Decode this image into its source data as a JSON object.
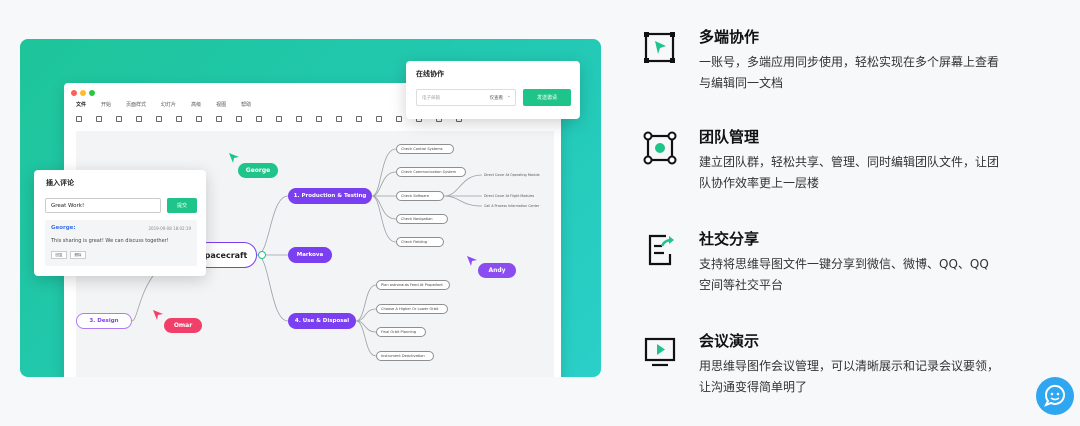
{
  "editor": {
    "menu": [
      "文件",
      "开始",
      "页面样式",
      "幻灯片",
      "高级",
      "视图",
      "帮助"
    ],
    "root_node": "pacecraft",
    "branches": [
      {
        "label": "1. Production & Testing",
        "color": "#7b3ff2"
      },
      {
        "label": "Markova",
        "color": "#7b3ff2"
      },
      {
        "label": "4. Use & Disposal",
        "color": "#7b3ff2"
      },
      {
        "label": "3. Design",
        "color": "#7b3ff2"
      }
    ],
    "leaves_top": [
      "Check Control Systems",
      "Check Communication System",
      "Check Software",
      "Check Navigation",
      "Check Fielding"
    ],
    "leaves_software": [
      "Direct Cover At Operating Module",
      "Direct Cover At Flight Modules",
      "Call A Process Information Center"
    ],
    "leaves_bottom": [
      "Plan astronauts Feed At Propellant",
      "Choose A Higher Or Lower Orbit",
      "Final Orbit Planning",
      "Instrument Deactivation"
    ],
    "collaborators": [
      {
        "name": "George",
        "color": "#1fc48a"
      },
      {
        "name": "Andy",
        "color": "#8b4cf0"
      },
      {
        "name": "Omar",
        "color": "#f0406a"
      }
    ]
  },
  "collab_card": {
    "title": "在线协作",
    "input_placeholder": "电子邮箱",
    "permission": "仅查看",
    "button": "发送邀请"
  },
  "comment_card": {
    "title": "插入评论",
    "input_value": "Great Work!",
    "submit": "提交",
    "author": "George:",
    "time": "2019-09-08 18:02:19",
    "text": "This sharing is great! We can discuss together!",
    "reply": "回复",
    "delete": "删除"
  },
  "features": [
    {
      "title": "多端协作",
      "desc": "一账号，多端应用同步使用，轻松实现在多个屏幕上查看与编辑同一文档",
      "icon": "multi-device-icon"
    },
    {
      "title": "团队管理",
      "desc": "建立团队群，轻松共享、管理、同时编辑团队文件，让团队协作效率更上一层楼",
      "icon": "team-icon"
    },
    {
      "title": "社交分享",
      "desc": "支持将思维导图文件一键分享到微信、微博、QQ、QQ空间等社交平台",
      "icon": "share-icon"
    },
    {
      "title": "会议演示",
      "desc": "用思维导图作会议管理，可以清晰展示和记录会议要领，让沟通变得简单明了",
      "icon": "presentation-icon"
    }
  ],
  "colors": {
    "accent": "#1fc48a",
    "purple": "#7b3ff2",
    "chat": "#2ea7f0"
  }
}
